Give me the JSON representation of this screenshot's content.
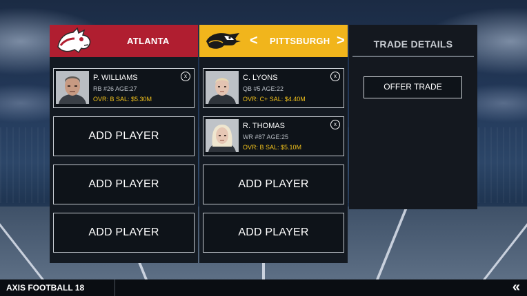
{
  "teams": {
    "left": {
      "name": "ATLANTA",
      "logo_icon": "horse-mascot-icon",
      "color": "#b01e30"
    },
    "right": {
      "name": "PITTSBURGH",
      "logo_icon": "eagle-mascot-icon",
      "color": "#f1b51c",
      "prev_icon": "chevron-left-icon",
      "next_icon": "chevron-right-icon",
      "prev_label": "<",
      "next_label": ">"
    }
  },
  "left_slots": {
    "player1": {
      "name": "P. WILLIAMS",
      "info": "RB  #26  AGE:27",
      "stats": "OVR: B   SAL: $5.30M",
      "remove": "x"
    },
    "add1": "ADD PLAYER",
    "add2": "ADD PLAYER",
    "add3": "ADD PLAYER"
  },
  "right_slots": {
    "player1": {
      "name": "C. LYONS",
      "info": "QB  #5  AGE:22",
      "stats": "OVR: C+   SAL: $4.40M",
      "remove": "x"
    },
    "player2": {
      "name": "R. THOMAS",
      "info": "WR  #87  AGE:25",
      "stats": "OVR: B   SAL: $5.10M",
      "remove": "x"
    },
    "add1": "ADD PLAYER",
    "add2": "ADD PLAYER"
  },
  "trade": {
    "title": "TRADE DETAILS",
    "offer_label": "OFFER TRADE"
  },
  "footer": {
    "brand": "AXIS FOOTBALL 18",
    "back_icon": "double-chevron-left-icon",
    "back_label": "«"
  },
  "colors": {
    "accent_yellow": "#f2c21b",
    "panel": "#141a22"
  }
}
